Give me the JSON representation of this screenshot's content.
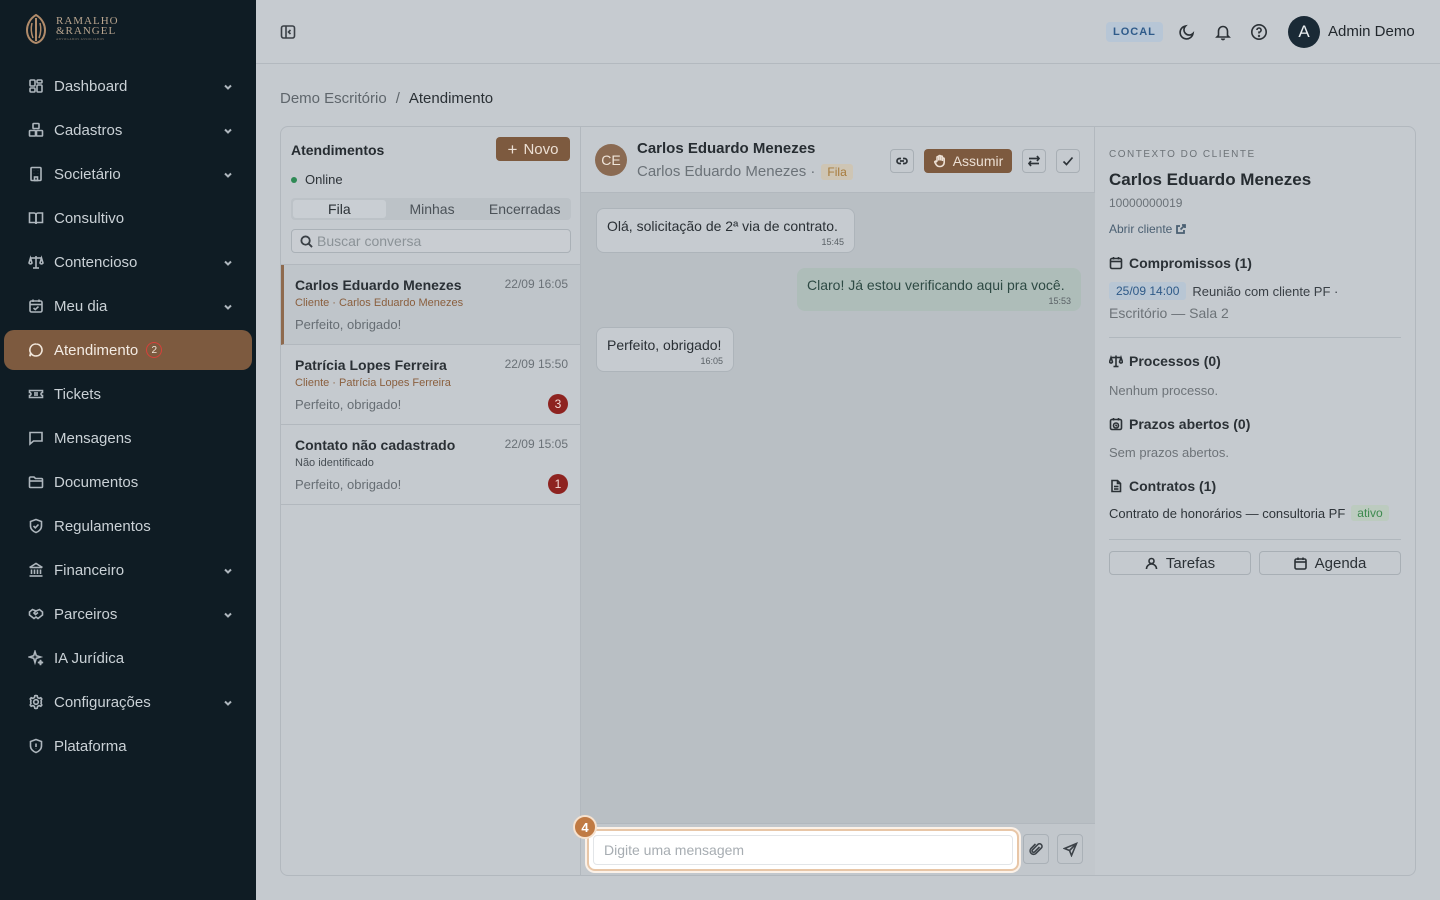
{
  "brand": {
    "name_line1": "RAMALHO",
    "name_line2": "&RANGEL",
    "tagline": "ADVOGADOS ASSOCIADOS",
    "accent_color": "#7d5a3f"
  },
  "sidebar": {
    "items": [
      {
        "label": "Dashboard",
        "icon": "dashboard-icon",
        "expandable": true
      },
      {
        "label": "Cadastros",
        "icon": "boxes-icon",
        "expandable": true
      },
      {
        "label": "Societário",
        "icon": "building-icon",
        "expandable": true
      },
      {
        "label": "Consultivo",
        "icon": "book-icon",
        "expandable": false
      },
      {
        "label": "Contencioso",
        "icon": "scale-icon",
        "expandable": true
      },
      {
        "label": "Meu dia",
        "icon": "calendar-icon",
        "expandable": true
      },
      {
        "label": "Atendimento",
        "icon": "chat-icon",
        "expandable": false,
        "active": true,
        "badge": "2"
      },
      {
        "label": "Tickets",
        "icon": "ticket-icon",
        "expandable": false
      },
      {
        "label": "Mensagens",
        "icon": "message-icon",
        "expandable": false
      },
      {
        "label": "Documentos",
        "icon": "folder-icon",
        "expandable": false
      },
      {
        "label": "Regulamentos",
        "icon": "shield-icon",
        "expandable": false
      },
      {
        "label": "Financeiro",
        "icon": "bank-icon",
        "expandable": true
      },
      {
        "label": "Parceiros",
        "icon": "handshake-icon",
        "expandable": true
      },
      {
        "label": "IA Jurídica",
        "icon": "sparkle-icon",
        "expandable": false
      },
      {
        "label": "Configurações",
        "icon": "gear-icon",
        "expandable": true
      },
      {
        "label": "Plataforma",
        "icon": "shield-check-icon",
        "expandable": false
      }
    ]
  },
  "topbar": {
    "env_badge": "LOCAL",
    "user_initial": "A",
    "user_name": "Admin Demo"
  },
  "breadcrumb": {
    "root": "Demo Escritório",
    "separator": "/",
    "current": "Atendimento"
  },
  "list": {
    "title": "Atendimentos",
    "new_label": "Novo",
    "status": "Online",
    "tabs": [
      "Fila",
      "Minhas",
      "Encerradas"
    ],
    "search_placeholder": "Buscar conversa",
    "conversations": [
      {
        "name": "Carlos Eduardo Menezes",
        "time": "22/09 16:05",
        "sub": "Cliente · Carlos Eduardo Menezes",
        "preview": "Perfeito, obrigado!",
        "unread": ""
      },
      {
        "name": "Patrícia Lopes Ferreira",
        "time": "22/09 15:50",
        "sub": "Cliente · Patrícia Lopes Ferreira",
        "preview": "Perfeito, obrigado!",
        "unread": "3"
      },
      {
        "name": "Contato não cadastrado",
        "time": "22/09 15:05",
        "sub": "Não identificado",
        "preview": "Perfeito, obrigado!",
        "unread": "1"
      }
    ]
  },
  "chat": {
    "initials": "CE",
    "name": "Carlos Eduardo Menezes",
    "sub_name": "Carlos Eduardo Menezes ·",
    "status_badge": "Fila",
    "assumir_label": "Assumir",
    "messages": [
      {
        "text": "Olá, solicitação de 2ª via de contrato.",
        "time": "15:45",
        "dir": "in"
      },
      {
        "text": "Claro! Já estou verificando aqui pra você.",
        "time": "15:53",
        "dir": "out"
      },
      {
        "text": "Perfeito, obrigado!",
        "time": "16:05",
        "dir": "in"
      }
    ],
    "composer_placeholder": "Digite uma mensagem",
    "step_badge": "4"
  },
  "context": {
    "label": "CONTEXTO DO CLIENTE",
    "name": "Carlos Eduardo Menezes",
    "id": "10000000019",
    "open_link": "Abrir cliente",
    "compromissos_title": "Compromissos (1)",
    "compromisso_date": "25/09 14:00",
    "compromisso_desc": "Reunião com cliente PF ·",
    "compromisso_place": "Escritório — Sala 2",
    "processos_title": "Processos (0)",
    "processos_empty": "Nenhum processo.",
    "prazos_title": "Prazos abertos (0)",
    "prazos_empty": "Sem prazos abertos.",
    "contratos_title": "Contratos (1)",
    "contrato_desc": "Contrato de honorários — consultoria PF",
    "contrato_status": "ativo",
    "tarefas_label": "Tarefas",
    "agenda_label": "Agenda"
  }
}
